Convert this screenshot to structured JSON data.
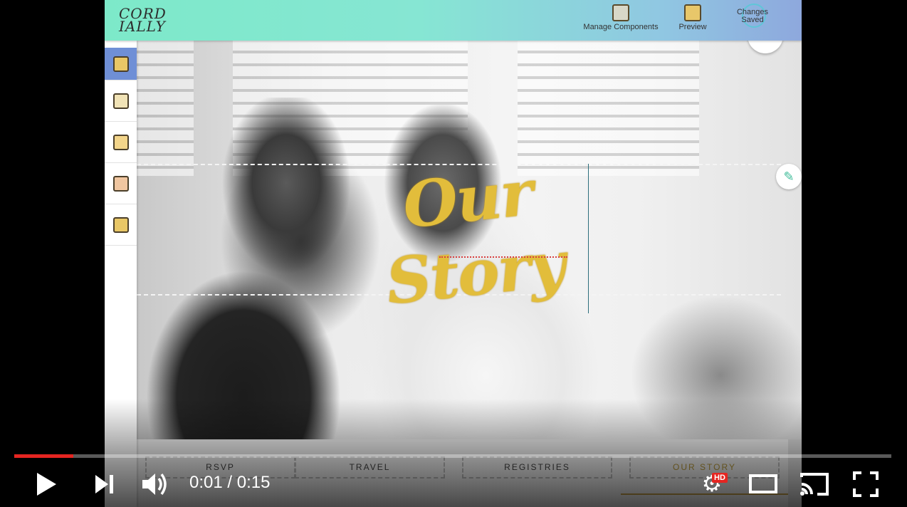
{
  "app": {
    "logo_line1": "CORD",
    "logo_line2": "IALLY",
    "toolbar": {
      "manage_components": "Manage Components",
      "preview": "Preview",
      "status_line1": "Changes",
      "status_line2": "Saved"
    },
    "sidebar_icons": [
      "info-card-icon",
      "photo-edit-icon",
      "rsvp-envelope-icon",
      "email-envelope-icon",
      "settings-gear-icon"
    ],
    "hero": {
      "title": "Our Story"
    },
    "nav": {
      "items": [
        "RSVP",
        "TRAVEL",
        "REGISTRIES",
        "OUR STORY"
      ],
      "active_index": 3
    },
    "colors": {
      "topbar_start": "#7de9c9",
      "topbar_end": "#8ea8dd",
      "title_gold": "#e2bd3b",
      "sidebar_active": "#6f8fd6"
    }
  },
  "player": {
    "time_current": "0:01",
    "time_separator": " / ",
    "time_total": "0:15",
    "progress_fraction": 0.067,
    "quality_badge": "HD"
  }
}
